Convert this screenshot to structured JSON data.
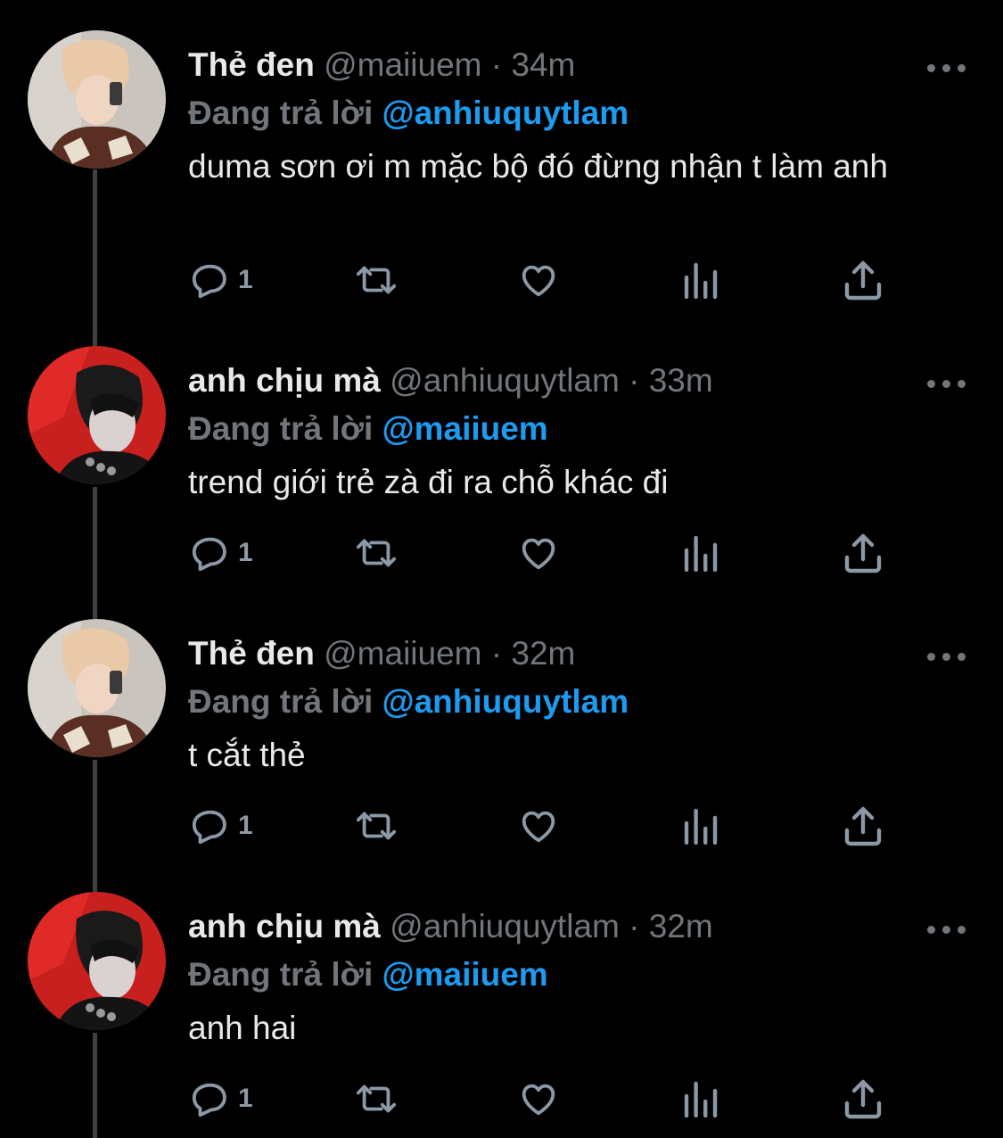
{
  "tweets": [
    {
      "name": "Thẻ đen",
      "handle": "@maiiuem",
      "sep": "·",
      "time": "34m",
      "replying_label": "Đang trả lời",
      "mention": "@anhiuquytlam",
      "text": "duma sơn ơi m mặc bộ đó đừng nhận t làm anh",
      "reply_count": "1",
      "avatar": "white-hair-phone"
    },
    {
      "name": "anh chịu mà",
      "handle": "@anhiuquytlam",
      "sep": "·",
      "time": "33m",
      "replying_label": "Đang trả lời",
      "mention": "@maiiuem",
      "text": "trend giới trẻ zà đi ra chỗ khác đi",
      "reply_count": "1",
      "avatar": "red-background-portrait"
    },
    {
      "name": "Thẻ đen",
      "handle": "@maiiuem",
      "sep": "·",
      "time": "32m",
      "replying_label": "Đang trả lời",
      "mention": "@anhiuquytlam",
      "text": "t cắt thẻ",
      "reply_count": "1",
      "avatar": "white-hair-phone"
    },
    {
      "name": "anh chịu mà",
      "handle": "@anhiuquytlam",
      "sep": "·",
      "time": "32m",
      "replying_label": "Đang trả lời",
      "mention": "@maiiuem",
      "text": "anh hai",
      "reply_count": "1",
      "avatar": "red-background-portrait"
    }
  ],
  "icons": [
    "reply-icon",
    "retweet-icon",
    "like-icon",
    "analytics-icon",
    "share-icon",
    "more-icon"
  ],
  "colors": {
    "background": "#000000",
    "text": "#e7e9ea",
    "muted": "#71767b",
    "link": "#1d9bf0",
    "thread_line": "#3e4144"
  }
}
